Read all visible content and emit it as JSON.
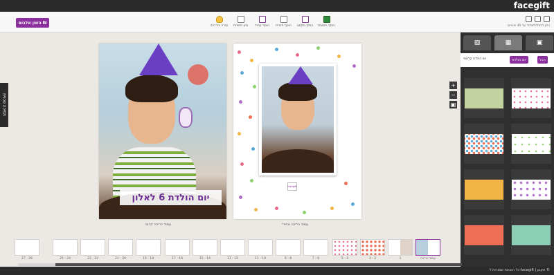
{
  "app": {
    "logo": "facegift"
  },
  "toolbar": {
    "order_label": "הזמן אלבום ₪",
    "tools": [
      {
        "label": "עזרה והדרכה",
        "icon": "lightbulb-icon"
      },
      {
        "label": "מיון תמונות",
        "icon": "sort-icon"
      },
      {
        "label": "הוסף עמוד",
        "icon": "add-page-icon"
      },
      {
        "label": "הוסף תבנית",
        "icon": "add-template-icon"
      },
      {
        "label": "הוסף טקסט",
        "icon": "add-text-icon"
      },
      {
        "label": "הוסף תמונות",
        "icon": "add-photos-icon"
      }
    ],
    "undo_text": "ניתן לבטל/לשחזר עד 40 שינויים"
  },
  "right_panel": {
    "tabs": [
      "backgrounds-icon",
      "layouts-icon",
      "photos-icon"
    ],
    "breadcrumb_back": "הכל",
    "breadcrumb_current": "יום הולדת",
    "subcategory": "יום הולדת קלאסי",
    "backgrounds": [
      {
        "color": "#ffffff",
        "pattern": "dots"
      },
      {
        "color": "#c3d39f",
        "pattern": "plain"
      },
      {
        "color": "#ffffff",
        "pattern": "sparse-dots"
      },
      {
        "color": "#ffffff",
        "pattern": "confetti"
      },
      {
        "color": "#ffffff",
        "pattern": "confetti"
      },
      {
        "color": "#f2b545",
        "pattern": "plain"
      },
      {
        "color": "#8ccfb4",
        "pattern": "plain"
      },
      {
        "color": "#ee6d55",
        "pattern": "plain"
      }
    ]
  },
  "left_tab": {
    "label": "תמיכה טכנית"
  },
  "spread": {
    "front_title": "יום הולדת 6 לאלון",
    "front_caption": "עמוד כריכה קדמי",
    "back_caption": "עמוד כריכה אחורי",
    "back_logo": "facegift"
  },
  "pages_strip": {
    "labels": [
      "27 - 26",
      "25 - 24",
      "23 - 22",
      "21 - 20",
      "19 - 18",
      "17 - 16",
      "15 - 14",
      "13 - 12",
      "11 - 10",
      "9 - 8",
      "7 - 6",
      "5 - 4",
      "3 - 2",
      "1",
      "עמוד כריכה"
    ]
  },
  "footer": {
    "text": "כל הזכויות שמורות ל-facegift | תקנון ©"
  }
}
